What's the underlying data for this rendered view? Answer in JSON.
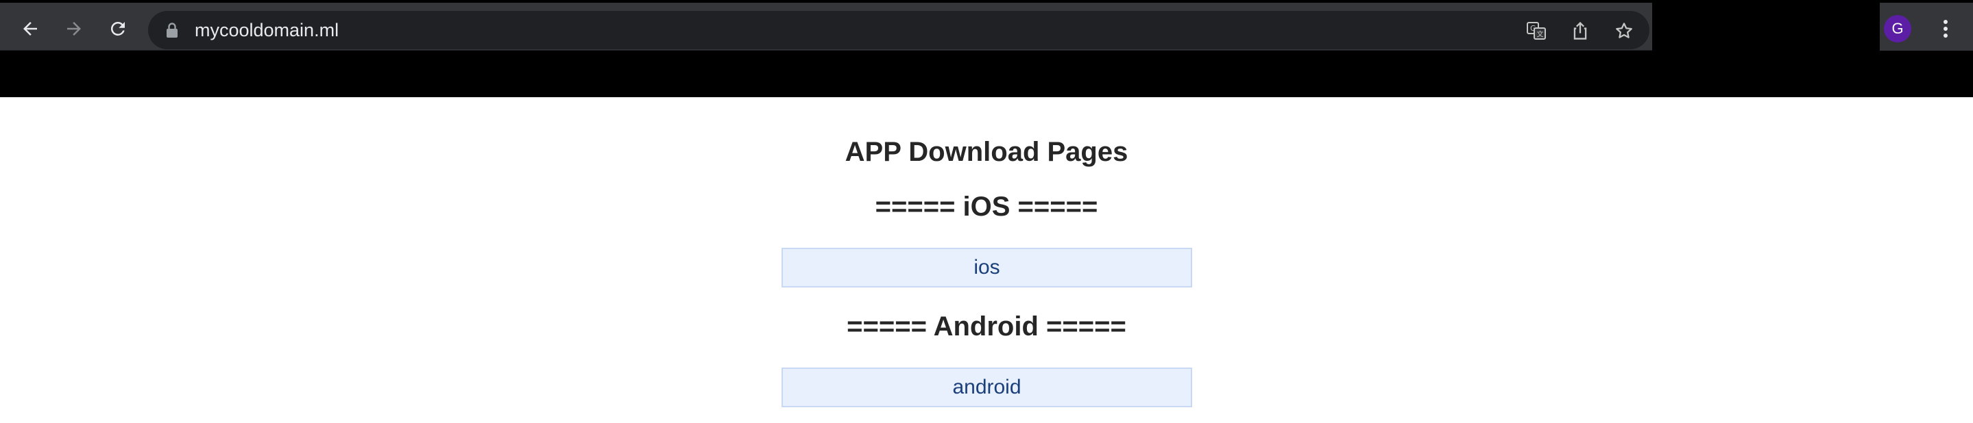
{
  "browser": {
    "url": "mycooldomain.ml",
    "profile_initial": "G",
    "icons": {
      "back": "arrow-left-icon",
      "forward": "arrow-right-icon",
      "reload": "reload-icon",
      "lock": "lock-icon",
      "translate": "translate-icon",
      "share": "share-icon",
      "bookmark": "star-icon",
      "menu": "vertical-dots-icon"
    },
    "colors": {
      "toolbar": "#35363a",
      "omnibox": "#202124",
      "avatar": "#5b1ea5"
    }
  },
  "page": {
    "title": "APP Download Pages",
    "sections": [
      {
        "heading": "===== iOS =====",
        "link_label": "ios"
      },
      {
        "heading": "===== Android =====",
        "link_label": "android"
      }
    ],
    "colors": {
      "link_bg": "#e8f0fe",
      "link_text": "#1b3f7a",
      "heading_text": "#262626"
    }
  }
}
